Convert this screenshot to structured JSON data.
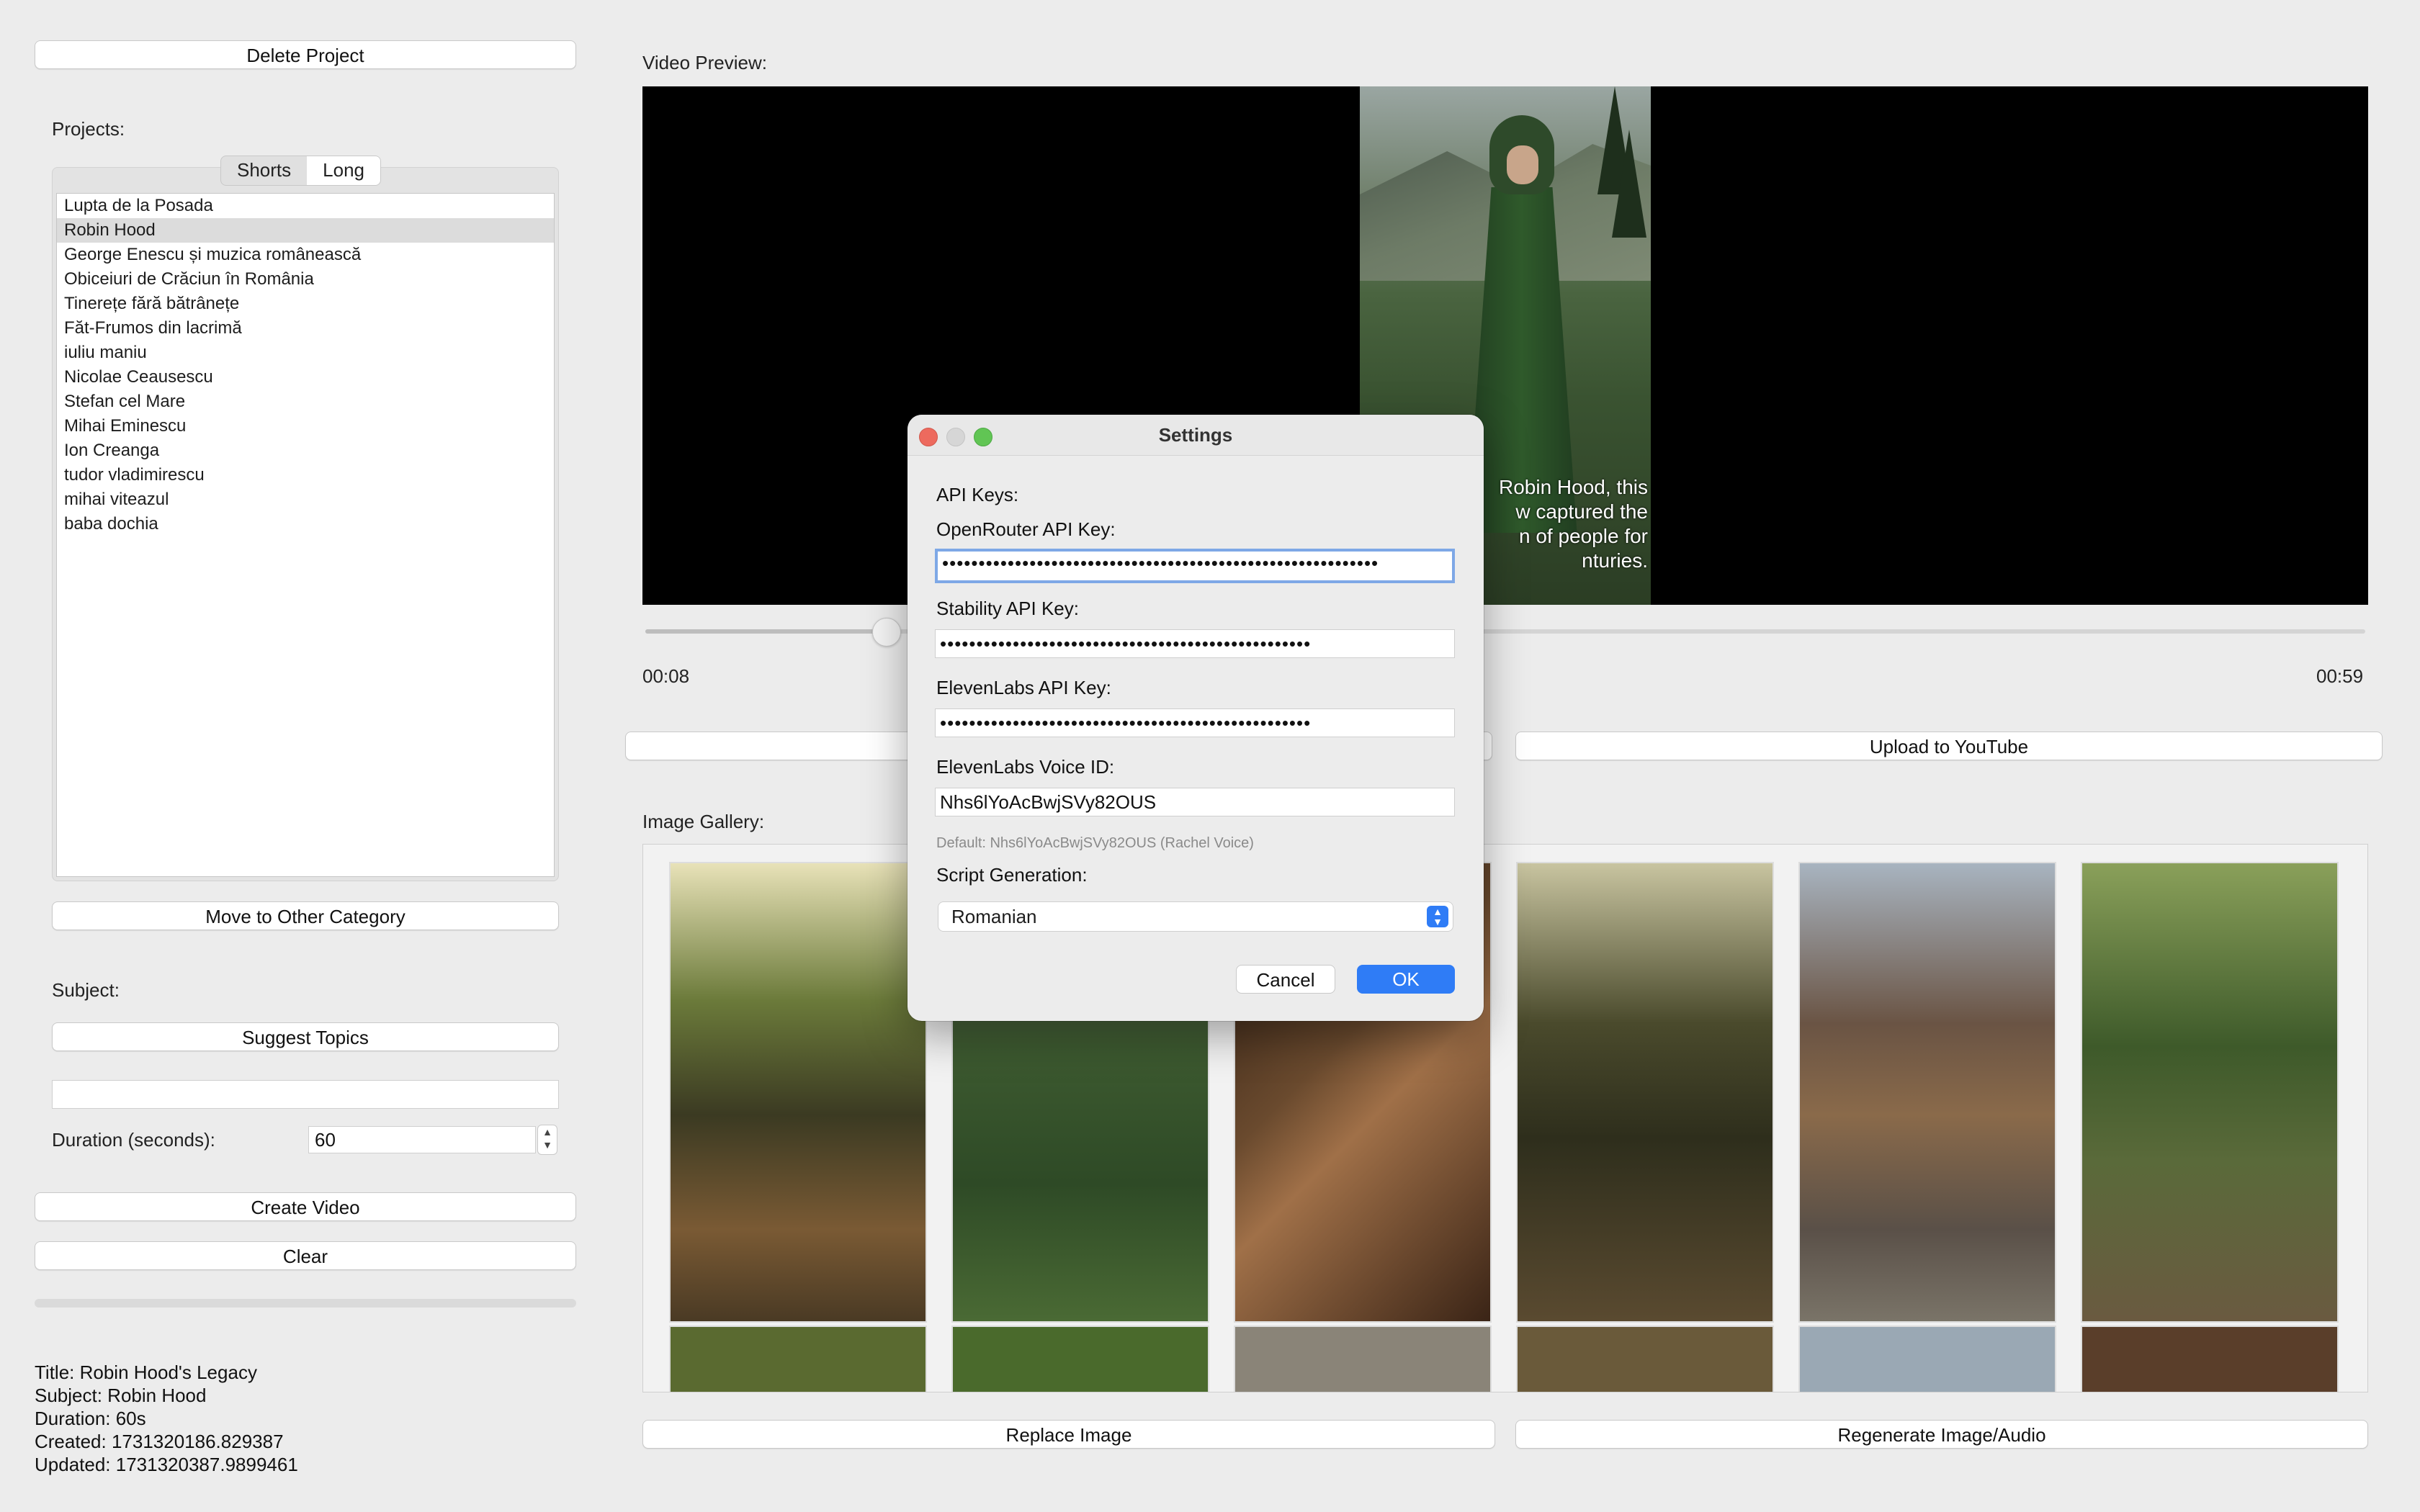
{
  "left": {
    "delete_project": "Delete Project",
    "projects_label": "Projects:",
    "tabs": [
      "Shorts",
      "Long"
    ],
    "projects": [
      "Lupta de la Posada",
      "Robin Hood",
      "George Enescu și muzica românească",
      "Obiceiuri de Crăciun în România",
      "Tinerețe fără bătrânețe",
      "Făt-Frumos din lacrimă",
      "iuliu maniu",
      "Nicolae Ceausescu",
      "Stefan cel Mare",
      "Mihai Eminescu",
      "Ion Creanga",
      "tudor vladimirescu",
      "mihai viteazul",
      "baba dochia"
    ],
    "selected_project": "Robin Hood",
    "move_category": "Move to Other Category",
    "subject_label": "Subject:",
    "suggest_topics": "Suggest Topics",
    "subject_value": "",
    "duration_label": "Duration (seconds):",
    "duration_value": "60",
    "create_video": "Create Video",
    "clear": "Clear",
    "info": {
      "title": "Title: Robin Hood's Legacy",
      "subject": "Subject: Robin Hood",
      "duration": "Duration: 60s",
      "created": "Created: 1731320186.829387",
      "updated": "Updated: 1731320387.9899461"
    }
  },
  "preview": {
    "label": "Video Preview:",
    "caption_lines": [
      "Robin Hood, this",
      "w captured the",
      "n of people for",
      "nturies."
    ],
    "time_current": "00:08",
    "time_total": "00:59",
    "progress": 0.14,
    "upload": "Upload to YouTube"
  },
  "gallery": {
    "label": "Image Gallery:",
    "replace": "Replace Image",
    "regenerate": "Regenerate Image/Audio"
  },
  "dialog": {
    "title": "Settings",
    "api_keys": "API Keys:",
    "openrouter_label": "OpenRouter API Key:",
    "openrouter_value": "••••••••••••••••••••••••••••••••••••••••••••••••••••••••••••",
    "stability_label": "Stability API Key:",
    "stability_value": "•••••••••••••••••••••••••••••••••••••••••••••••••••",
    "elevenlabs_label": "ElevenLabs API Key:",
    "elevenlabs_value": "•••••••••••••••••••••••••••••••••••••••••••••••••••",
    "voice_label": "ElevenLabs Voice ID:",
    "voice_value": "Nhs6lYoAcBwjSVy82OUS",
    "voice_hint": "Default: Nhs6lYoAcBwjSVy82OUS (Rachel Voice)",
    "script_label": "Script Generation:",
    "script_value": "Romanian",
    "cancel": "Cancel",
    "ok": "OK"
  },
  "colors": {
    "accent": "#2f7cf6",
    "window_bg": "#ececec"
  }
}
